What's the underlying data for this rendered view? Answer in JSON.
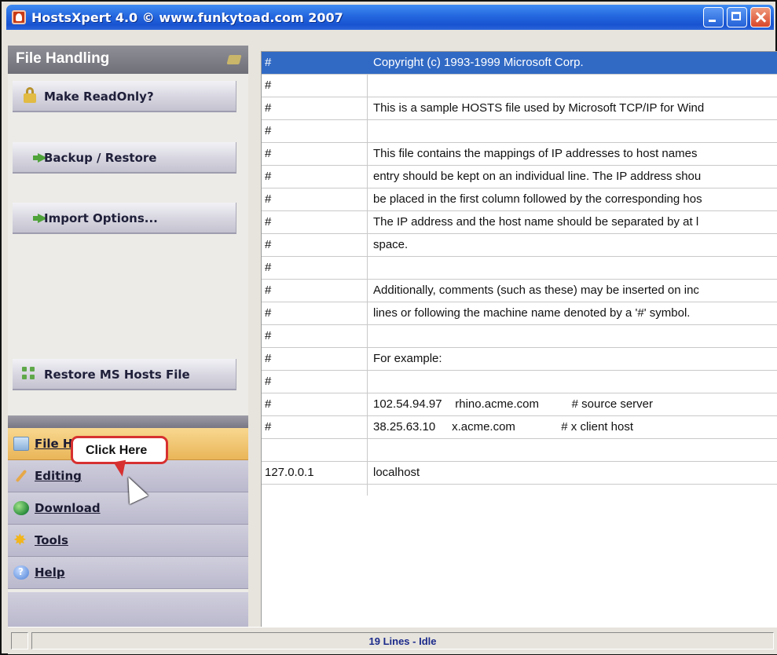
{
  "window": {
    "title": "HostsXpert 4.0 © www.funkytoad.com 2007",
    "icon": "funkytoad-app-icon",
    "controls": [
      "minimize",
      "maximize",
      "close"
    ]
  },
  "left_panel": {
    "header": "File Handling",
    "header_icon": "panel-pin-icon",
    "actions": [
      {
        "label": "Make ReadOnly?",
        "icon": "lock-icon"
      },
      {
        "label": "Backup / Restore",
        "icon": "green-arrow-icon"
      },
      {
        "label": "Import Options...",
        "icon": "green-arrow-icon"
      },
      {
        "label": "Restore MS Hosts File",
        "icon": "restore-dots-icon"
      }
    ],
    "nav": [
      {
        "label": "File Handling",
        "visible_label": "File H",
        "icon": "file-folder-icon",
        "active": true
      },
      {
        "label": "Editing",
        "icon": "wrench-icon",
        "active": false
      },
      {
        "label": "Download",
        "icon": "globe-icon",
        "active": false
      },
      {
        "label": "Tools",
        "icon": "star-burst-icon",
        "active": false
      },
      {
        "label": "Help",
        "icon": "help-icon",
        "active": false
      }
    ]
  },
  "callout": {
    "text": "Click Here"
  },
  "hosts_table": {
    "selected_row": 0,
    "rows": [
      [
        "#",
        "Copyright (c) 1993-1999 Microsoft Corp."
      ],
      [
        "#",
        ""
      ],
      [
        "#",
        "This is a sample HOSTS file used by Microsoft TCP/IP for Wind"
      ],
      [
        "#",
        ""
      ],
      [
        "#",
        "This file contains the mappings of IP addresses to host names"
      ],
      [
        "#",
        "entry should be kept on an individual line. The IP address shou"
      ],
      [
        "#",
        "be placed in the first column followed by the corresponding hos"
      ],
      [
        "#",
        "The IP address and the host name should be separated by at l"
      ],
      [
        "#",
        "space."
      ],
      [
        "#",
        ""
      ],
      [
        "#",
        "Additionally, comments (such as these) may be inserted on inc"
      ],
      [
        "#",
        "lines or following the machine name denoted by a '#' symbol."
      ],
      [
        "#",
        ""
      ],
      [
        "#",
        "For example:"
      ],
      [
        "#",
        ""
      ],
      [
        "#",
        "102.54.94.97    rhino.acme.com          # source server"
      ],
      [
        "#",
        "38.25.63.10     x.acme.com              # x client host"
      ],
      [
        "",
        ""
      ],
      [
        "127.0.0.1",
        "localhost"
      ]
    ]
  },
  "status": {
    "text": "19 Lines - Idle"
  },
  "colors": {
    "titlebar": "#2467df",
    "selected_row": "#316ac5",
    "active_nav": "#f2c670",
    "callout_border": "#d73030",
    "status_text": "#1b2a8a"
  }
}
